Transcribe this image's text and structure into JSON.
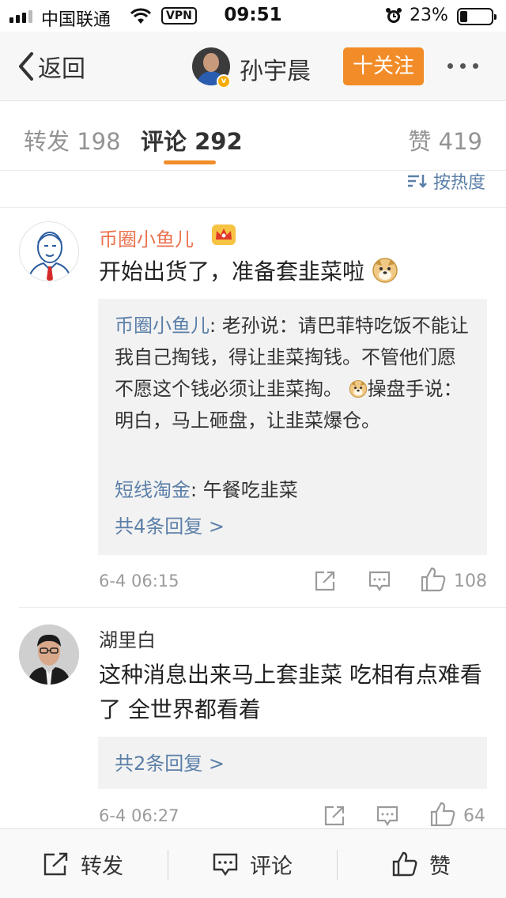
{
  "status_bar": {
    "carrier": "中国联通",
    "vpn": "VPN",
    "time": "09:51",
    "battery_pct": "23%",
    "battery_level": 0.23
  },
  "nav": {
    "back_label": "返回",
    "user_name": "孙宇晨",
    "follow_label": "十关注"
  },
  "tabs": {
    "repost": "转发 198",
    "comment": "评论 292",
    "like": "赞 419",
    "sort_label": "按热度"
  },
  "comments": [
    {
      "user": "币圈小鱼儿",
      "text": "开始出货了，准备套韭菜啦",
      "replies": [
        {
          "name": "币圈小鱼儿",
          "text_before_emoji": ": 老孙说：请巴菲特吃饭不能让我自己掏钱，得让韭菜掏钱。不管他们愿不愿这个钱必须让韭菜掏。",
          "text_after_emoji": "操盘手说：明白，马上砸盘，让韭菜爆仓。"
        },
        {
          "name": "短线淘金",
          "text": ": 午餐吃韭菜"
        }
      ],
      "more_replies": "共4条回复 >",
      "time": "6-4 06:15",
      "likes": "108"
    },
    {
      "user": "湖里白",
      "text": "这种消息出来马上套韭菜 吃相有点难看了 全世界都看着",
      "more_replies": "共2条回复 >",
      "time": "6-4 06:27",
      "likes": "64"
    }
  ],
  "bottom_bar": {
    "repost": "转发",
    "comment": "评论",
    "like": "赞"
  },
  "colors": {
    "accent_orange": "#f28c28",
    "link_blue": "#5b7fa8",
    "vip_name": "#eb7350"
  }
}
